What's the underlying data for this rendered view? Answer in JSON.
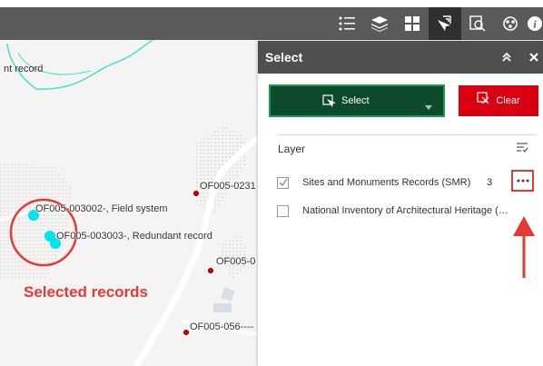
{
  "toolbar": {
    "icons": [
      "legend-icon",
      "layers-icon",
      "basemap-gallery-icon",
      "select-tool-icon",
      "query-icon",
      "analysis-icon",
      "info-icon"
    ]
  },
  "map": {
    "labels": {
      "record_left": "nt record",
      "field_system": "OF005-003002-, Field system",
      "redundant": "OF005-003003-, Redundant record",
      "of023": "OF005-0231",
      "of0": "OF005-0",
      "of056": "OF005-056----"
    },
    "annotation": "Selected records",
    "colors": {
      "selected_point": "#00e5ee",
      "unselected_point": "#cc0000",
      "annotation": "#e53935"
    }
  },
  "panel": {
    "title": "Select",
    "select_label": "Select",
    "clear_label": "Clear",
    "layer_heading": "Layer",
    "layers": [
      {
        "name": "Sites and Monuments Records (SMR)",
        "count": "3",
        "checked": true
      },
      {
        "name": "National Inventory of Architectural Heritage (…",
        "count": "",
        "checked": false
      }
    ],
    "colors": {
      "select_bg": "#0c4a2b",
      "select_border": "#1b9a51",
      "clear_bg": "#d90012",
      "header_bg": "#4f4f4f"
    }
  }
}
